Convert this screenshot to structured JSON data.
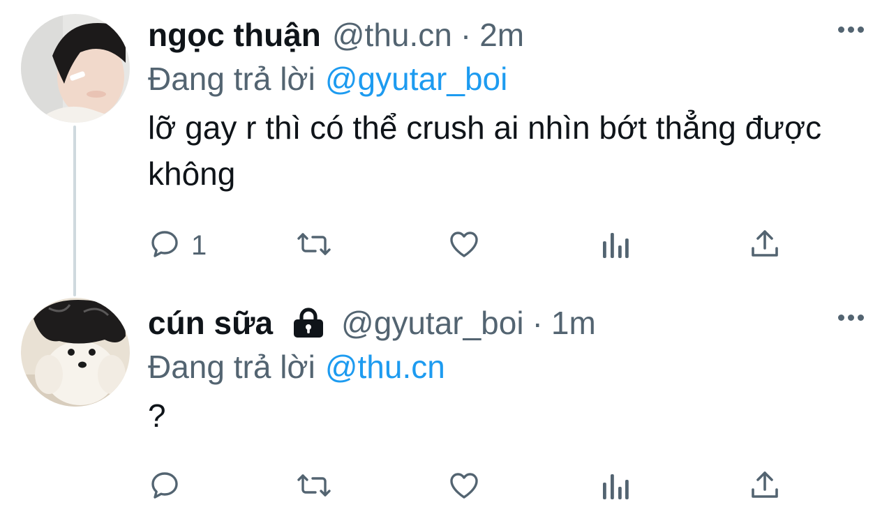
{
  "tweets": [
    {
      "name": "ngọc thuận",
      "handle": "@thu.cn",
      "separator": "·",
      "time": "2m",
      "replying_prefix": "Đang trả lời",
      "replying_to": "@gyutar_boi",
      "text": "lỡ gay r thì có thể crush ai nhìn bớt thẳng được không",
      "reply_count": "1",
      "locked": false
    },
    {
      "name": "cún sữa",
      "handle": "@gyutar_boi",
      "separator": "·",
      "time": "1m",
      "replying_prefix": "Đang trả lời",
      "replying_to": "@thu.cn",
      "text": "?",
      "reply_count": "",
      "locked": true
    }
  ],
  "icons": {
    "reply": "reply-icon",
    "retweet": "retweet-icon",
    "like": "heart-icon",
    "analytics": "analytics-icon",
    "share": "share-icon",
    "more": "more-icon",
    "lock": "lock-icon"
  },
  "colors": {
    "text": "#0f1419",
    "secondary": "#536471",
    "link": "#1d9bf0",
    "thread_line": "#cfd9de"
  }
}
